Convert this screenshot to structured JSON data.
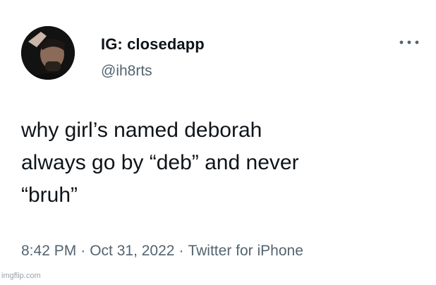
{
  "user": {
    "display_name": "IG: closedapp",
    "handle": "@ih8rts",
    "avatar_icon": "profile-photo"
  },
  "menu": {
    "icon": "more-horizontal-icon"
  },
  "tweet": {
    "lines": [
      "why girl’s named deborah",
      "always go by “deb” and never",
      "“bruh”"
    ]
  },
  "meta": {
    "time": "8:42 PM",
    "separator": "·",
    "date": "Oct 31, 2022",
    "source": "Twitter for iPhone"
  },
  "watermark": "imgflip.com",
  "colors": {
    "text": "#0f1419",
    "secondary": "#536471",
    "background": "#ffffff"
  }
}
